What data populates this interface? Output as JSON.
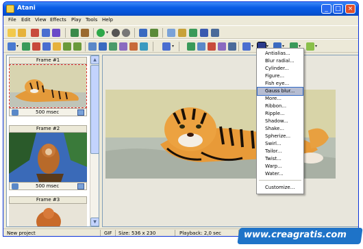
{
  "window": {
    "title": "Atani"
  },
  "menu": [
    "File",
    "Edit",
    "View",
    "Effects",
    "Play",
    "Tools",
    "Help"
  ],
  "frames": [
    {
      "title": "Frame #1",
      "duration": "500 msec"
    },
    {
      "title": "Frame #2",
      "duration": "500 msec"
    },
    {
      "title": "Frame #3"
    }
  ],
  "dropdown": {
    "items": [
      "Antialias...",
      "Blur radial...",
      "Cylinder...",
      "Figure...",
      "Fish eye...",
      "Gauss blur...",
      "More...",
      "Ribbon...",
      "Ripple...",
      "Shadow...",
      "Shake...",
      "Spherize...",
      "Swirl...",
      "Tailor...",
      "Twist...",
      "Warp...",
      "Water..."
    ],
    "highlighted": "Gauss blur...",
    "customize": "Customize..."
  },
  "status": {
    "project": "New project",
    "format": "GIF",
    "size": "Size: 536 x 230",
    "playback": "Playback: 2,0 sec"
  },
  "watermark": "www.creagratis.com",
  "colors": {
    "titlebar": "#0554d6",
    "close_button": "#e0502c",
    "highlight": "#b6bdd2",
    "watermark_bg": "#1e73c8"
  }
}
